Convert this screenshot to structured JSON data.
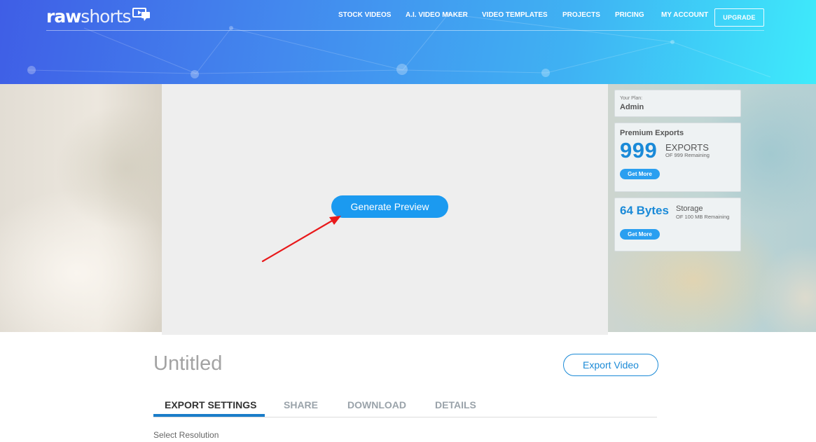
{
  "header": {
    "logo": {
      "bold": "raw",
      "light": "shorts"
    },
    "nav": [
      {
        "label": "STOCK VIDEOS"
      },
      {
        "label": "A.I. VIDEO MAKER"
      },
      {
        "label": "VIDEO TEMPLATES"
      },
      {
        "label": "PROJECTS"
      },
      {
        "label": "PRICING"
      },
      {
        "label": "MY ACCOUNT"
      }
    ],
    "upgrade_label": "UPGRADE"
  },
  "preview": {
    "generate_label": "Generate Preview"
  },
  "sidebar": {
    "plan": {
      "caption": "Your Plan:",
      "value": "Admin"
    },
    "exports": {
      "title": "Premium Exports",
      "count": "999",
      "unit": "EXPORTS",
      "note": "OF 999 Remaining",
      "get_more_label": "Get More"
    },
    "storage": {
      "value": "64 Bytes",
      "unit": "Storage",
      "note": "OF 100 MB Remaining",
      "get_more_label": "Get More"
    }
  },
  "main": {
    "title": "Untitled",
    "export_label": "Export Video",
    "tabs": [
      {
        "label": "EXPORT SETTINGS",
        "active": true
      },
      {
        "label": "SHARE",
        "active": false
      },
      {
        "label": "DOWNLOAD",
        "active": false
      },
      {
        "label": "DETAILS",
        "active": false
      }
    ],
    "section_label": "Select Resolution"
  },
  "icons": {
    "logo_icon": "speech-bubble-play-icon",
    "annotation": "red-arrow-icon"
  },
  "colors": {
    "accent": "#1b9af0",
    "brand_dark": "#1a7dc9",
    "header_start": "#3f5ee6",
    "header_end": "#3eebfb",
    "annotation": "#e8191b"
  }
}
